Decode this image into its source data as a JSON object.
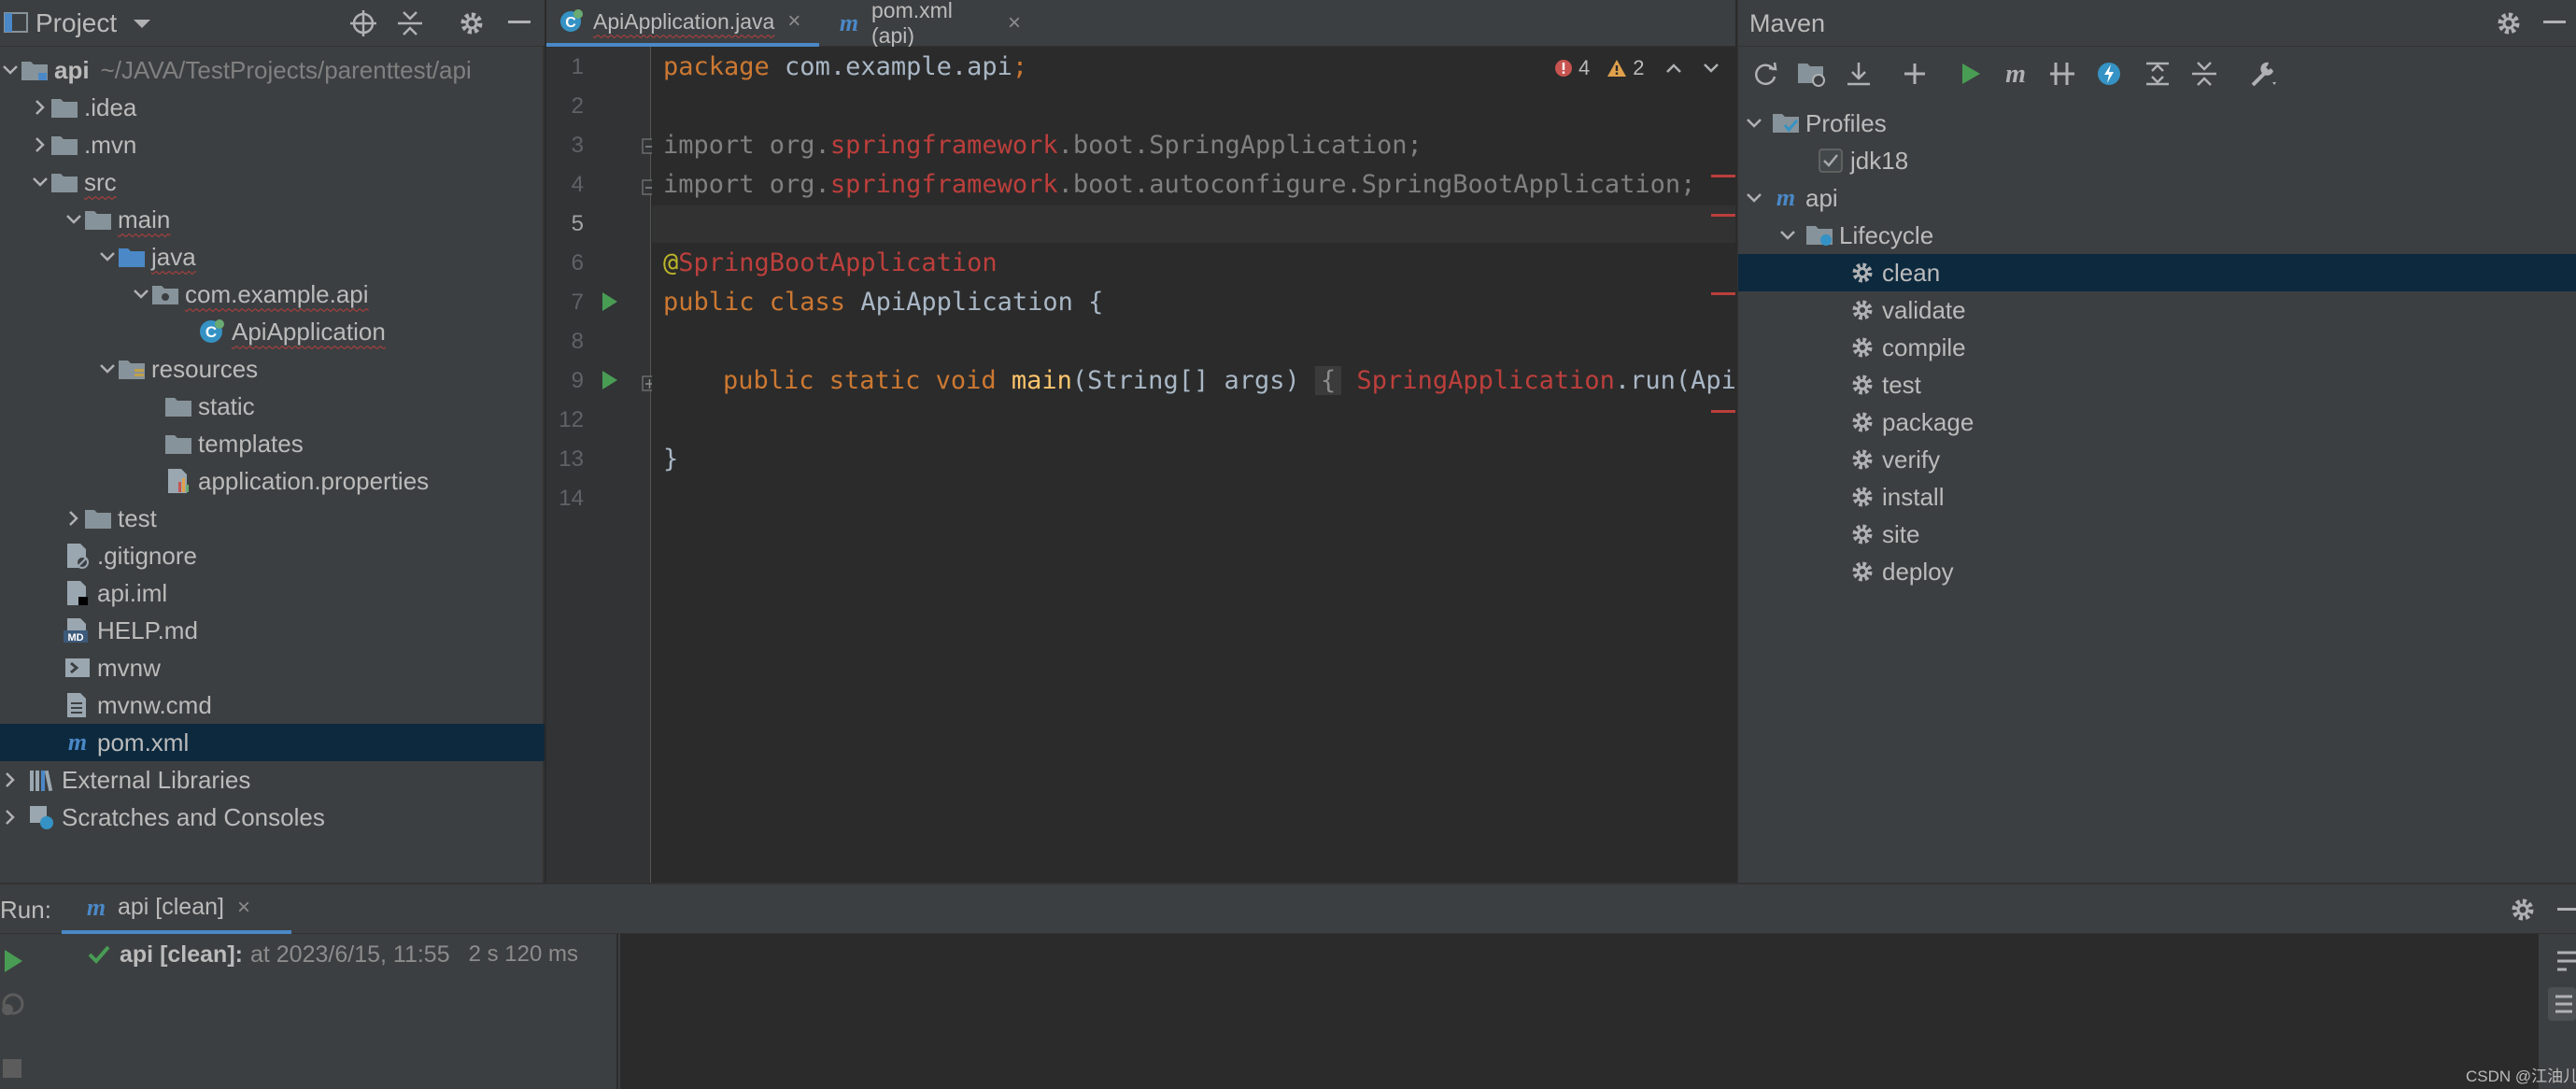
{
  "project_panel": {
    "title": "Project",
    "tree": [
      {
        "label": "api",
        "path": "~/JAVA/TestProjects/parenttest/api",
        "icon": "module-folder-icon"
      },
      {
        "label": ".idea",
        "icon": "folder-icon"
      },
      {
        "label": ".mvn",
        "icon": "folder-icon"
      },
      {
        "label": "src",
        "icon": "folder-icon"
      },
      {
        "label": "main",
        "icon": "folder-icon"
      },
      {
        "label": "java",
        "icon": "source-folder-icon"
      },
      {
        "label": "com.example.api",
        "icon": "package-icon"
      },
      {
        "label": "ApiApplication",
        "icon": "spring-class-icon"
      },
      {
        "label": "resources",
        "icon": "resources-folder-icon"
      },
      {
        "label": "static",
        "icon": "folder-icon"
      },
      {
        "label": "templates",
        "icon": "folder-icon"
      },
      {
        "label": "application.properties",
        "icon": "properties-file-icon"
      },
      {
        "label": "test",
        "icon": "folder-icon"
      },
      {
        "label": ".gitignore",
        "icon": "ignore-file-icon"
      },
      {
        "label": "api.iml",
        "icon": "iml-file-icon"
      },
      {
        "label": "HELP.md",
        "icon": "markdown-file-icon"
      },
      {
        "label": "mvnw",
        "icon": "shell-file-icon"
      },
      {
        "label": "mvnw.cmd",
        "icon": "text-file-icon"
      },
      {
        "label": "pom.xml",
        "icon": "maven-file-icon"
      },
      {
        "label": "External Libraries",
        "icon": "libraries-icon"
      },
      {
        "label": "Scratches and Consoles",
        "icon": "scratches-icon"
      }
    ]
  },
  "editor": {
    "tabs": [
      {
        "label": "ApiApplication.java",
        "active": true
      },
      {
        "label": "pom.xml (api)",
        "active": false
      }
    ],
    "inspections": {
      "errors": "4",
      "warnings": "2"
    },
    "line_numbers": [
      "1",
      "2",
      "3",
      "4",
      "5",
      "6",
      "7",
      "8",
      "9",
      "12",
      "13",
      "14"
    ],
    "code": {
      "l1_kw": "package",
      "l1_rest": " com.example.api",
      "l1_semi": ";",
      "l3_import": "import org.",
      "l3_red": "springframework",
      "l3_rest": ".boot.SpringApplication;",
      "l4_import": "import org.",
      "l4_red": "springframework",
      "l4_rest": ".boot.autoconfigure.SpringBootApplication;",
      "l6_at": "@",
      "l6_ann": "SpringBootApplication",
      "l7_kw": "public class",
      "l7_rest": " ApiApplication {",
      "l9_kw": "public static void",
      "l9_fn": "main",
      "l9_params": "(String[] args)",
      "l9_brace": "{",
      "l9_red": "SpringApplication",
      "l9_rest": ".run(ApiApplication.class, args); }",
      "l13": "}"
    }
  },
  "maven_panel": {
    "title": "Maven",
    "tree": [
      {
        "label": "Profiles"
      },
      {
        "label": "jdk18"
      },
      {
        "label": "api"
      },
      {
        "label": "Lifecycle"
      },
      {
        "label": "clean"
      },
      {
        "label": "validate"
      },
      {
        "label": "compile"
      },
      {
        "label": "test"
      },
      {
        "label": "package"
      },
      {
        "label": "verify"
      },
      {
        "label": "install"
      },
      {
        "label": "site"
      },
      {
        "label": "deploy"
      }
    ]
  },
  "run_panel": {
    "label": "Run:",
    "tab_label": "api [clean]",
    "entry_title": "api [clean]:",
    "entry_time": "at 2023/6/15, 11:55",
    "entry_duration": "2 s 120 ms"
  },
  "watermark": "CSDN @江油儿",
  "colors": {
    "panel_bg": "#3c3f41",
    "editor_bg": "#2b2b2b",
    "selection": "#0d293e",
    "keyword": "#cc7832",
    "error": "#bc3f3c",
    "run_green": "#499c54"
  }
}
